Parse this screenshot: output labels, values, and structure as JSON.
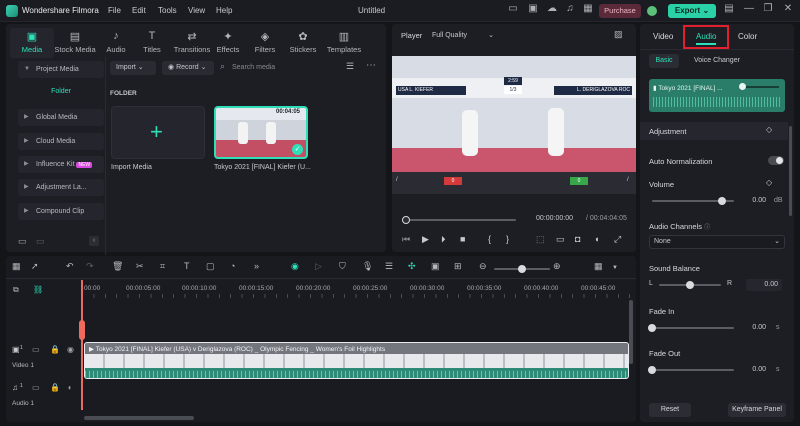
{
  "app": {
    "name": "Wondershare Filmora",
    "window_title": "Untitled"
  },
  "menu": [
    "File",
    "Edit",
    "Tools",
    "View",
    "Help"
  ],
  "titlebar": {
    "purchase": "Purchase",
    "export": "Export"
  },
  "media_tabs": [
    {
      "label": "Media",
      "icon": "media-icon"
    },
    {
      "label": "Stock Media",
      "icon": "stock-icon"
    },
    {
      "label": "Audio",
      "icon": "music-icon"
    },
    {
      "label": "Titles",
      "icon": "text-icon"
    },
    {
      "label": "Transitions",
      "icon": "transition-icon"
    },
    {
      "label": "Effects",
      "icon": "effects-icon"
    },
    {
      "label": "Filters",
      "icon": "filter-icon"
    },
    {
      "label": "Stickers",
      "icon": "sticker-icon"
    },
    {
      "label": "Templates",
      "icon": "template-icon"
    }
  ],
  "sidebar": {
    "project_media": "Project Media",
    "folder": "Folder",
    "items": [
      "Global Media",
      "Cloud Media",
      "Influence Kit",
      "Adjustment La...",
      "Compound Clip"
    ],
    "new_badge": "NEW"
  },
  "media_toolbar": {
    "import": "Import",
    "record": "Record",
    "search_placeholder": "Search media"
  },
  "media_area": {
    "folder_label": "FOLDER",
    "import_label": "Import Media",
    "clip_name": "Tokyo 2021 [FINAL] Kiefer (U...",
    "clip_duration": "00:04:05"
  },
  "player": {
    "label": "Player",
    "quality": "Full Quality",
    "current_time": "00:00:00:00",
    "total_time": "/ 00:04:04:05",
    "video_text": {
      "left_name": "L. KIEFER",
      "right_name": "L. DERIGLAZOVA",
      "score_top": "2:59",
      "score_mid": "1/3",
      "left_score": "0",
      "right_score": "0",
      "left_code": "USA",
      "right_code": "ROC",
      "bottom_left": "/",
      "bottom_right": "/"
    }
  },
  "props": {
    "tabs": [
      "Video",
      "Audio",
      "Color"
    ],
    "active_tab": "Audio",
    "subtabs": [
      "Basic",
      "Voice Changer"
    ],
    "clip_title": "Tokyo 2021 [FINAL] ...",
    "adjustment": "Adjustment",
    "auto_normalization": "Auto Normalization",
    "volume": {
      "label": "Volume",
      "value": "0.00",
      "unit": "dB",
      "level": 0.85
    },
    "audio_channels": {
      "label": "Audio Channels",
      "value": "None"
    },
    "sound_balance": {
      "label": "Sound Balance",
      "value": "0.00",
      "left": "L",
      "right": "R",
      "level": 0.5
    },
    "fade_in": {
      "label": "Fade In",
      "value": "0.00",
      "unit": "s",
      "level": 0.0
    },
    "fade_out": {
      "label": "Fade Out",
      "value": "0.00",
      "unit": "s",
      "level": 0.0
    },
    "reset": "Reset",
    "keyframe": "Keyframe Panel"
  },
  "timeline": {
    "ruler": [
      "00:00",
      "00:00:05:00",
      "00:00:10:00",
      "00:00:15:00",
      "00:00:20:00",
      "00:00:25:00",
      "00:00:30:00",
      "00:00:35:00",
      "00:00:40:00",
      "00:00:45:00"
    ],
    "clip_title": "Tokyo 2021 [FINAL] Kiefer (USA) v Deriglazova (ROC) _ Olympic Fencing _ Women's Foil Highlights",
    "video_track": "Video 1",
    "audio_track": "Audio 1",
    "track_num_video": "1",
    "track_num_audio": "1"
  }
}
